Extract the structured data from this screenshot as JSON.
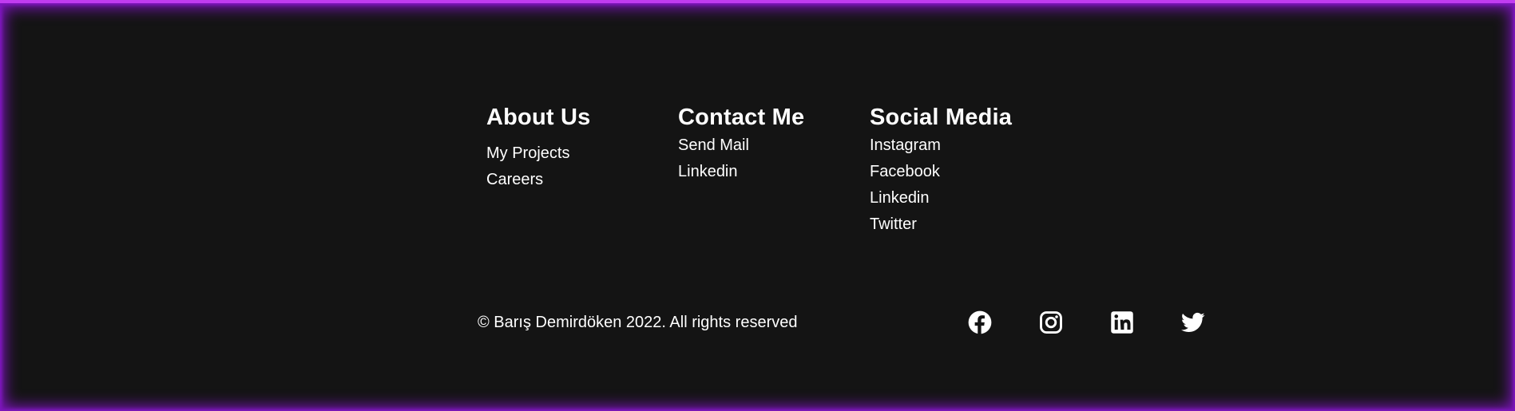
{
  "colors": {
    "background": "#141414",
    "accent": "#c13cf0",
    "text": "#ffffff"
  },
  "about": {
    "heading": "About Us",
    "links": [
      "My Projects",
      "Careers"
    ]
  },
  "contact": {
    "heading": "Contact Me",
    "links": [
      "Send Mail",
      "Linkedin"
    ]
  },
  "social": {
    "heading": "Social Media",
    "links": [
      "Instagram",
      "Facebook",
      "Linkedin",
      "Twitter"
    ]
  },
  "copyright": "© Barış Demirdöken 2022. All rights reserved",
  "social_icons": [
    "facebook-icon",
    "instagram-icon",
    "linkedin-icon",
    "twitter-icon"
  ]
}
